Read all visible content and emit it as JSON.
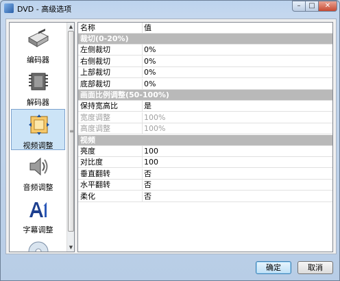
{
  "window": {
    "title": "DVD - 高级选项",
    "controls": {
      "minimize": "–",
      "maximize": "□",
      "close": "✕"
    }
  },
  "sidebar": {
    "items": [
      {
        "label": "编码器",
        "icon": "encoder-icon",
        "selected": false
      },
      {
        "label": "解码器",
        "icon": "decoder-icon",
        "selected": false
      },
      {
        "label": "视频调整",
        "icon": "video-adjust-icon",
        "selected": true
      },
      {
        "label": "音频调整",
        "icon": "audio-adjust-icon",
        "selected": false
      },
      {
        "label": "字幕调整",
        "icon": "subtitle-adjust-icon",
        "selected": false
      },
      {
        "label": "",
        "icon": "disc-icon",
        "selected": false
      }
    ]
  },
  "grid": {
    "headers": {
      "name": "名称",
      "value": "值"
    },
    "rows": [
      {
        "type": "category",
        "name": "裁切(0-20%)"
      },
      {
        "type": "item",
        "name": "左侧裁切",
        "value": "0%"
      },
      {
        "type": "item",
        "name": "右侧裁切",
        "value": "0%"
      },
      {
        "type": "item",
        "name": "上部裁切",
        "value": "0%"
      },
      {
        "type": "item",
        "name": "底部裁切",
        "value": "0%"
      },
      {
        "type": "category",
        "name": "画面比例调整(50-100%)"
      },
      {
        "type": "item",
        "name": "保持宽高比",
        "value": "是"
      },
      {
        "type": "disabled",
        "name": "宽度调整",
        "value": "100%"
      },
      {
        "type": "disabled",
        "name": "高度调整",
        "value": "100%"
      },
      {
        "type": "category",
        "name": "视频"
      },
      {
        "type": "item",
        "name": "亮度",
        "value": "100"
      },
      {
        "type": "item",
        "name": "对比度",
        "value": "100"
      },
      {
        "type": "item",
        "name": "垂直翻转",
        "value": "否"
      },
      {
        "type": "item",
        "name": "水平翻转",
        "value": "否"
      },
      {
        "type": "item",
        "name": "柔化",
        "value": "否"
      }
    ]
  },
  "footer": {
    "ok_label": "确定",
    "cancel_label": "取消"
  },
  "colors": {
    "category_bg": "#b9b9b9",
    "selected_bg": "#cce4f7",
    "disabled_text": "#a0a0a0"
  }
}
